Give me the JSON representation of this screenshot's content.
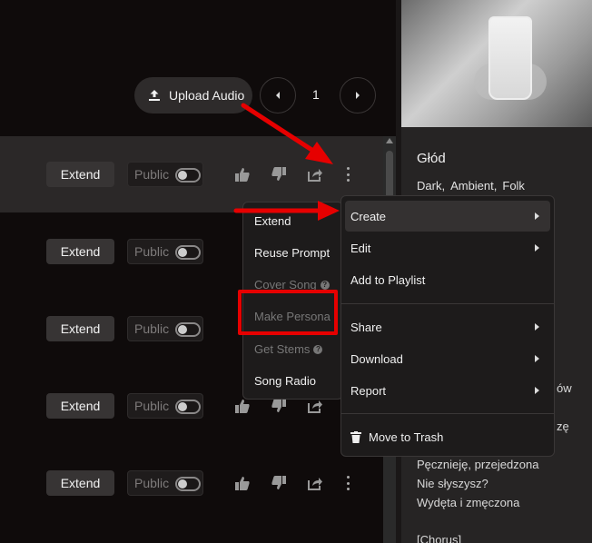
{
  "toolbar": {
    "upload_label": "Upload Audio",
    "page_number": "1"
  },
  "rows": [
    {
      "extend_label": "Extend",
      "public_label": "Public"
    },
    {
      "extend_label": "Extend",
      "public_label": "Public"
    },
    {
      "extend_label": "Extend",
      "public_label": "Public"
    },
    {
      "extend_label": "Extend",
      "public_label": "Public"
    },
    {
      "extend_label": "Extend",
      "public_label": "Public"
    }
  ],
  "submenu": {
    "extend": "Extend",
    "reuse_prompt": "Reuse Prompt",
    "cover_song": "Cover Song",
    "make_persona": "Make Persona",
    "get_stems": "Get Stems",
    "song_radio": "Song Radio"
  },
  "menu": {
    "create": "Create",
    "edit": "Edit",
    "add_to_playlist": "Add to Playlist",
    "share": "Share",
    "download": "Download",
    "report": "Report",
    "move_to_trash": "Move to Trash"
  },
  "song": {
    "title": "Głód",
    "tags": [
      "Dark,",
      "Ambient,",
      "Folk"
    ],
    "lyrics_fragments": [
      "ów",
      "zę"
    ],
    "lyrics": [
      "Pęcznieję, przejedzona",
      "Nie słyszysz?",
      "Wydęta i zmęczona",
      "[Chorus]"
    ]
  },
  "colors": {
    "annotation": "#e60000",
    "menu_bg": "#1d1b1b",
    "active_item": "#343131"
  }
}
